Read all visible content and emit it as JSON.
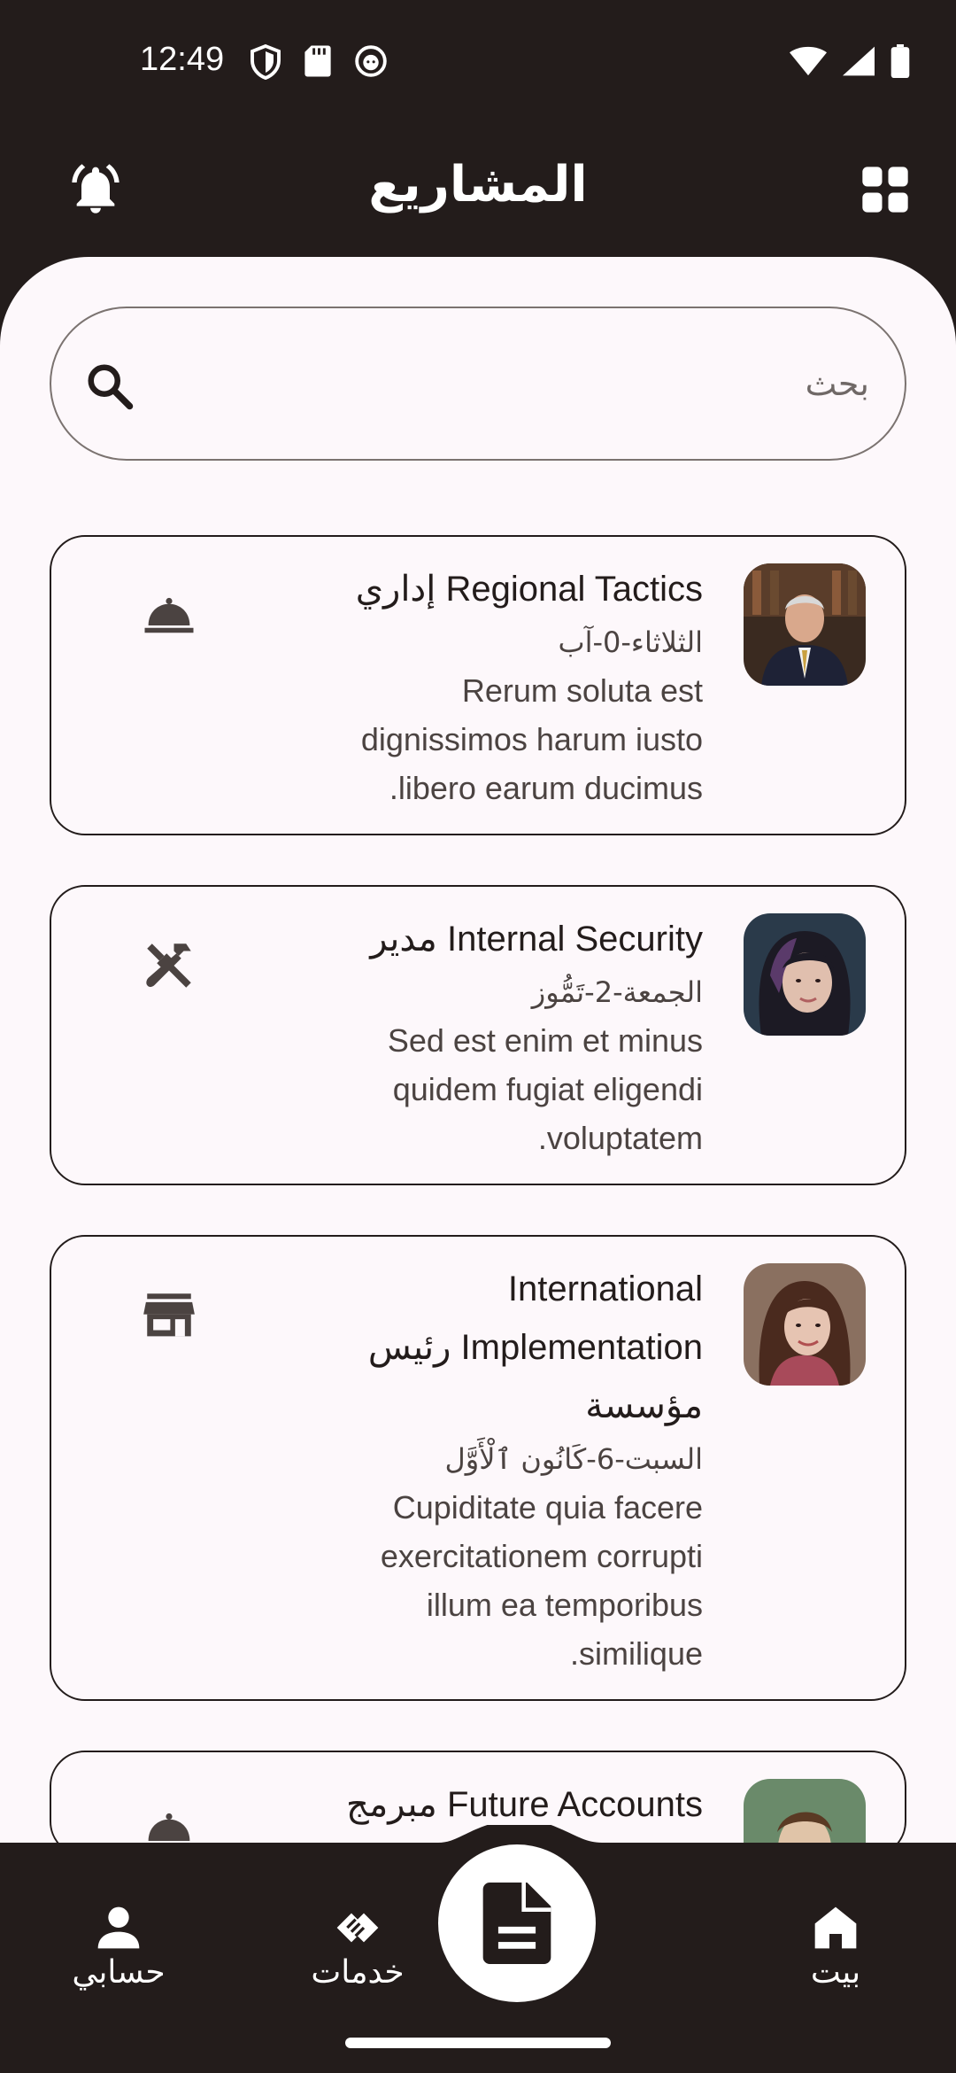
{
  "status_bar": {
    "time": "12:49",
    "icons_left": [
      "shield-icon",
      "sd-card-icon",
      "notification-app-icon"
    ],
    "icons_right": [
      "wifi-icon",
      "signal-icon",
      "battery-icon"
    ]
  },
  "app_bar": {
    "title": "المشاريع",
    "left_icon": "bell-ringing-icon",
    "right_icon": "grid-view-icon"
  },
  "search": {
    "placeholder": "بحث",
    "icon": "search-icon"
  },
  "projects": [
    {
      "title": "Regional Tactics إداري",
      "date": "الثلاثاء-0-آب",
      "description": "Rerum soluta est dignissimos harum iusto libero earum ducimus.",
      "action_icon": "service-bell-icon",
      "avatar_colors": [
        "#3a2a20",
        "#8c6a50",
        "#c9a98c"
      ]
    },
    {
      "title": "Internal Security مدير",
      "date": "الجمعة-2-تَمُّوز",
      "description": "Sed est enim et minus quidem fugiat eligendi voluptatem.",
      "action_icon": "tools-icon",
      "avatar_colors": [
        "#1c1a24",
        "#5a3a6a",
        "#d9b8a6"
      ]
    },
    {
      "title": "International Implementation رئيس مؤسسة",
      "date": "السبت-6-كَانُون ٱلْأَوَّل",
      "description": "Cupiditate quia facere exercitationem corrupti illum ea temporibus similique.",
      "action_icon": "store-icon",
      "avatar_colors": [
        "#6a4a3a",
        "#a84a5a",
        "#e0c0b0"
      ]
    },
    {
      "title": "Future Accounts مبرمج",
      "date": "",
      "description": "",
      "action_icon": "service-bell-icon",
      "avatar_colors": [
        "#4a6a4a",
        "#a08060",
        "#e0c8b0"
      ]
    }
  ],
  "bottom_nav": {
    "items": [
      {
        "label": "حسابي",
        "icon": "person-icon"
      },
      {
        "label": "خدمات",
        "icon": "handshake-icon"
      },
      {
        "label": "",
        "icon": "document-icon"
      },
      {
        "label": "بيت",
        "icon": "home-icon"
      }
    ]
  },
  "colors": {
    "primary_dark": "#231c1b",
    "surface": "#fdf8fb",
    "outline": "#7b7370",
    "text_secondary": "#4b4341"
  }
}
